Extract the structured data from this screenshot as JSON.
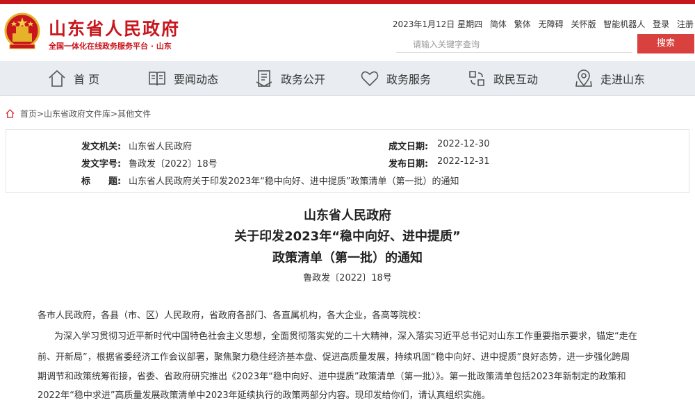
{
  "header": {
    "site_title": "山东省人民政府",
    "site_subtitle": "全国一体化在线政务服务平台 · 山东",
    "date": "2023年1月12日 星期四",
    "links": [
      "简体",
      "繁体",
      "无障碍",
      "关怀版",
      "智能机器人",
      "登录",
      "注册"
    ],
    "search_placeholder": "请输入关键字查询",
    "search_button": "搜索"
  },
  "nav": {
    "items": [
      {
        "label": "首 页",
        "icon": "home-icon"
      },
      {
        "label": "要闻动态",
        "icon": "book-icon"
      },
      {
        "label": "政务公开",
        "icon": "document-icon"
      },
      {
        "label": "政务服务",
        "icon": "heart-icon"
      },
      {
        "label": "政民互动",
        "icon": "interaction-icon"
      },
      {
        "label": "走进山东",
        "icon": "location-icon"
      }
    ]
  },
  "breadcrumb": "首页>山东省政府文件库>其他文件",
  "info": {
    "issuer_label": "发文机关:",
    "issuer": "山东省人民政府",
    "doc_no_label": "发文字号:",
    "doc_no": "鲁政发〔2022〕18号",
    "title_label": "标　　题:",
    "title": "山东省人民政府关于印发2023年“稳中向好、进中提质”政策清单（第一批）的通知",
    "created_label": "成文日期:",
    "created": "2022-12-30",
    "published_label": "发布日期:",
    "published": "2022-12-31"
  },
  "document": {
    "title_line1": "山东省人民政府",
    "title_line2": "关于印发2023年“稳中向好、进中提质”",
    "title_line3": "政策清单（第一批）的通知",
    "number": "鲁政发〔2022〕18号",
    "salutation": "各市人民政府，各县（市、区）人民政府，省政府各部门、各直属机构，各大企业，各高等院校：",
    "paragraph_lines": [
      "为深入学习贯彻习近平新时代中国特色社会主义思想，全面贯彻落实党的二十大精神，深入落实习近平总书记对山东工作重要指示要求，锚定“走在",
      "前、开新局”，根据省委经济工作会议部署，聚焦聚力稳住经济基本盘、促进高质量发展，持续巩固“稳中向好、进中提质”良好态势，进一步强化跨周",
      "期调节和政策统筹衔接，省委、省政府研究推出《2023年“稳中向好、进中提质”政策清单（第一批）》。第一批政策清单包括2023年新制定的政策和",
      "2022年“稳中求进”高质量发展政策清单中2023年延续执行的政策两部分内容。现印发给你们，请认真组织实施。"
    ]
  },
  "colors": {
    "brand_red": "#c8161d",
    "search_button": "#d9413f",
    "nav_bg": "#e9edf2"
  }
}
